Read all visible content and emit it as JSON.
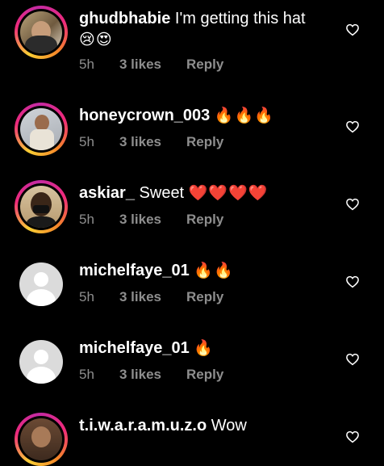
{
  "comments": [
    {
      "username": "ghudbhabie",
      "text": "I'm getting this hat",
      "emojis": [
        "😢",
        "😍"
      ],
      "time": "5h",
      "likes": "3 likes",
      "reply": "Reply",
      "avatar": "photo"
    },
    {
      "username": "honeycrown_003",
      "text": "",
      "emojis": [
        "🔥",
        "🔥",
        "🔥"
      ],
      "time": "5h",
      "likes": "3 likes",
      "reply": "Reply",
      "avatar": "photo"
    },
    {
      "username": "askiar_",
      "text": "Sweet",
      "emojis": [
        "❤️",
        "❤️",
        "❤️",
        "❤️"
      ],
      "time": "5h",
      "likes": "3 likes",
      "reply": "Reply",
      "avatar": "photo"
    },
    {
      "username": "michelfaye_01",
      "text": "",
      "emojis": [
        "🔥",
        "🔥"
      ],
      "time": "5h",
      "likes": "3 likes",
      "reply": "Reply",
      "avatar": "default"
    },
    {
      "username": "michelfaye_01",
      "text": "",
      "emojis": [
        "🔥"
      ],
      "time": "5h",
      "likes": "3 likes",
      "reply": "Reply",
      "avatar": "default"
    },
    {
      "username": "t.i.w.a.r.a.m.u.z.o",
      "text": "Wow",
      "emojis": [],
      "avatar": "photo"
    }
  ],
  "icons": {
    "like": "heart-outline-icon",
    "default_avatar": "default-avatar-icon"
  },
  "colors": {
    "background": "#000000",
    "text": "#ffffff",
    "meta": "#8e8e8e",
    "story_ring": "#ee2a7b"
  }
}
